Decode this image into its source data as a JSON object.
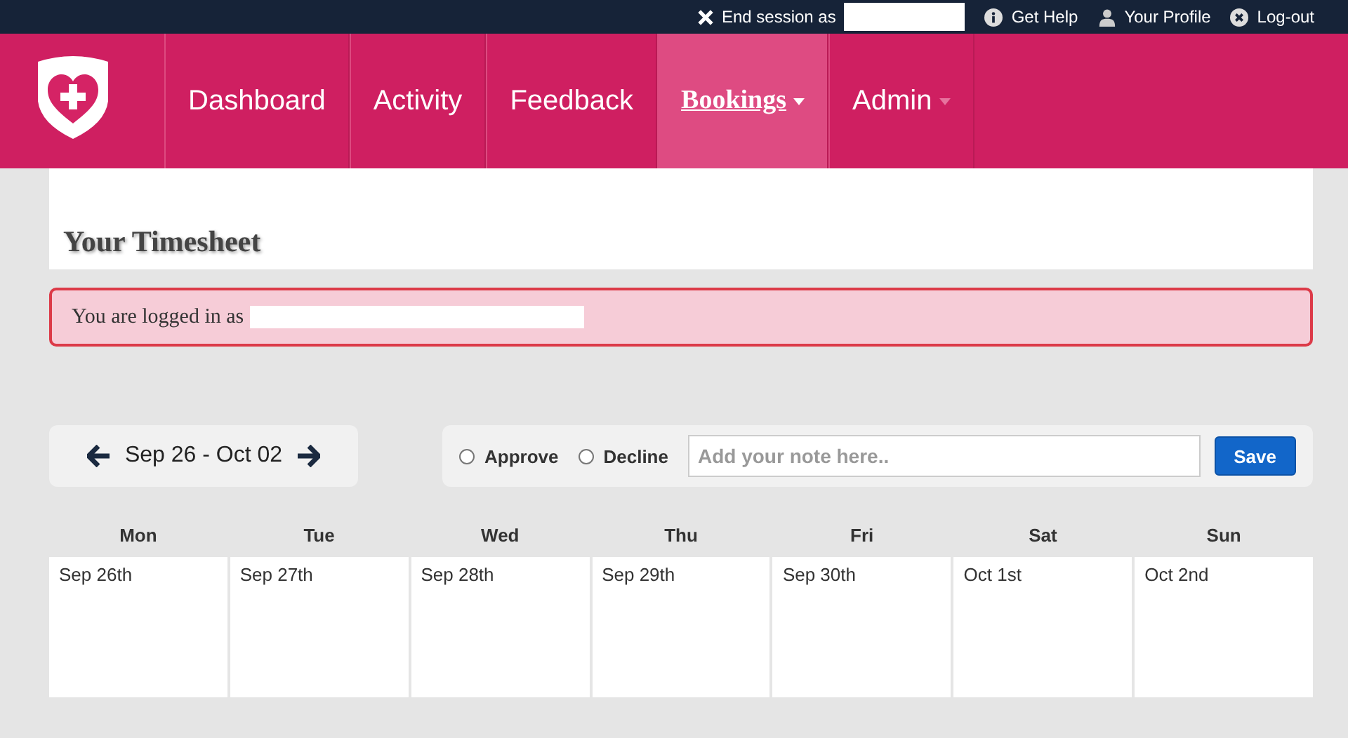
{
  "top_bar": {
    "end_session": "End session as",
    "links": [
      {
        "kind": "help",
        "label": "Get Help"
      },
      {
        "kind": "profile",
        "label": "Your Profile"
      },
      {
        "kind": "logout",
        "label": "Log-out"
      }
    ]
  },
  "nav": {
    "items": [
      {
        "label": "Dashboard",
        "selected": false,
        "dropdown": false
      },
      {
        "label": "Activity",
        "selected": false,
        "dropdown": false
      },
      {
        "label": "Feedback",
        "selected": false,
        "dropdown": false
      },
      {
        "label": "Bookings",
        "selected": true,
        "dropdown": true
      },
      {
        "label": "Admin",
        "selected": false,
        "dropdown": true
      }
    ]
  },
  "page_title": "Your Timesheet",
  "alert": "You are logged in as",
  "week": {
    "range": "Sep 26 - Oct 02"
  },
  "review": {
    "options": [
      {
        "label": "Approve",
        "selected": false
      },
      {
        "label": "Decline",
        "selected": false
      }
    ],
    "placeholder": "Add your note here..",
    "save": "Save"
  },
  "days": [
    {
      "name": "Mon",
      "date": "Sep 26th"
    },
    {
      "name": "Tue",
      "date": "Sep 27th"
    },
    {
      "name": "Wed",
      "date": "Sep 28th"
    },
    {
      "name": "Thu",
      "date": "Sep 29th"
    },
    {
      "name": "Fri",
      "date": "Sep 30th"
    },
    {
      "name": "Sat",
      "date": "Oct 1st"
    },
    {
      "name": "Sun",
      "date": "Oct 2nd"
    }
  ]
}
